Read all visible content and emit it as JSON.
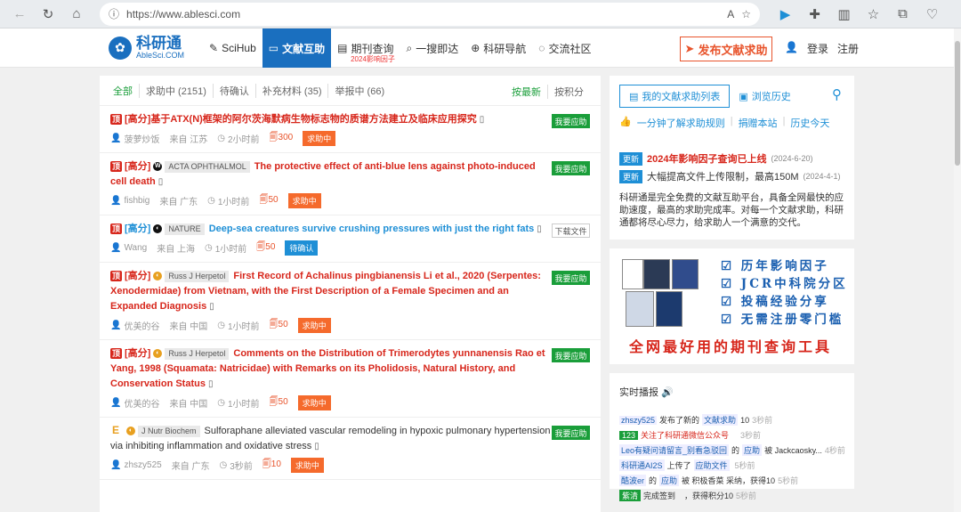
{
  "browser": {
    "url": "https://www.ablesci.com"
  },
  "header": {
    "logo_cn": "科研通",
    "logo_en": "AbleSci.COM",
    "nav": [
      {
        "label": "SciHub",
        "icon": "s"
      },
      {
        "label": "文献互助",
        "icon": "📖"
      },
      {
        "label": "期刊查询",
        "icon": "📄",
        "sub": "2024影响因子"
      },
      {
        "label": "一搜即达",
        "icon": "🔍"
      },
      {
        "label": "科研导航",
        "icon": "🌐"
      },
      {
        "label": "交流社区",
        "icon": "💬"
      }
    ],
    "publish": "发布文献求助",
    "login": "登录",
    "register": "注册"
  },
  "filters": {
    "items": [
      "全部",
      "求助中 (2151)",
      "待确认",
      "补充材料 (35)",
      "举报中 (66)"
    ],
    "sort": [
      "按最新",
      "按积分"
    ]
  },
  "requests": [
    {
      "tag": "顶",
      "prefix": "[高分]",
      "journal": "",
      "title": "基于ATX(N)框架的阿尔茨海默病生物标志物的质谱方法建立及临床应用探究",
      "color": "red",
      "user": "菠萝炒饭",
      "from": "来自 江苏",
      "time": "2小时前",
      "points": "300",
      "status": "求助中",
      "action": "我要应助"
    },
    {
      "tag": "顶",
      "prefix": "[高分]",
      "journal": "ACTA OPHTHALMOL",
      "title": "The protective effect of anti-blue lens against photo-induced cell death",
      "color": "red",
      "user": "fishbig",
      "from": "来自 广东",
      "time": "1小时前",
      "points": "50",
      "status": "求助中",
      "action": "我要应助"
    },
    {
      "tag": "顶",
      "prefix": "[高分]",
      "journal": "NATURE",
      "title": "Deep-sea creatures survive crushing pressures with just the right fats",
      "color": "blue",
      "user": "Wang",
      "from": "来自 上海",
      "time": "1小时前",
      "points": "50",
      "status": "待确认",
      "action": "下载文件"
    },
    {
      "tag": "顶",
      "prefix": "[高分]",
      "journal": "Russ J Herpetol",
      "title": "First Record of Achalinus pingbianensis Li et al., 2020 (Serpentes: Xenodermidae) from Vietnam, with the First Description of a Female Specimen and an Expanded Diagnosis",
      "color": "red",
      "user": "优美的谷",
      "from": "来自 中国",
      "time": "1小时前",
      "points": "50",
      "status": "求助中",
      "action": "我要应助"
    },
    {
      "tag": "顶",
      "prefix": "[高分]",
      "journal": "Russ J Herpetol",
      "title": "Comments on the Distribution of Trimerodytes yunnanensis Rao et Yang, 1998 (Squamata: Natricidae) with Remarks on its Pholidosis, Natural History, and Conservation Status",
      "color": "red",
      "user": "优美的谷",
      "from": "来自 中国",
      "time": "1小时前",
      "points": "50",
      "status": "求助中",
      "action": "我要应助"
    },
    {
      "tag": "E",
      "prefix": "",
      "journal": "J Nutr Biochem",
      "title": "Sulforaphane alleviated vascular remodeling in hypoxic pulmonary hypertension via inhibiting inflammation and oxidative stress",
      "color": "plain",
      "user": "zhszy525",
      "from": "来自 广东",
      "time": "3秒前",
      "points": "10",
      "status": "求助中",
      "action": "我要应助"
    }
  ],
  "sidebar": {
    "my_list": "我的文献求助列表",
    "history": "浏览历史",
    "links": [
      "一分钟了解求助规则",
      "捐赠本站",
      "历史今天"
    ],
    "news": [
      {
        "badge": "更新",
        "text": "2024年影响因子查询已上线",
        "date": "(2024-6-20)"
      },
      {
        "badge": "更新",
        "text": "大幅提高文件上传限制，最高150M",
        "date": "(2024-4-1)"
      }
    ],
    "intro": "科研通是完全免费的文献互助平台，具备全网最快的应助速度，最高的求助完成率。对每一个文献求助，科研通都将尽心尽力，给求助人一个满意的交代。",
    "ad": [
      "☑ 历年影响因子",
      "☑ JCR中科院分区",
      "☑ 投稿经验分享",
      "☑ 无需注册零门槛"
    ],
    "ad_bottom": "全网最好用的期刊查询工具",
    "live_title": "实时播报",
    "feed": [
      {
        "u": "zhszy525",
        "a": "发布了新的",
        "b": "文献求助",
        "c": "10",
        "t": "3秒前"
      },
      {
        "u": "123",
        "a": "关注了科研通微信公众号",
        "b": "",
        "c": "",
        "t": "3秒前"
      },
      {
        "u": "Leo有疑问请留言_别看急驳回",
        "a": "的",
        "b": "应助",
        "c": "被 Jackcaosky...",
        "t": "4秒前"
      },
      {
        "u": "科研通AI2S",
        "a": "上传了",
        "b": "应助文件",
        "c": "",
        "t": "5秒前"
      },
      {
        "u": "酷波er",
        "a": "的",
        "b": "应助",
        "c": "被 积极香菜 采纳，获得10",
        "t": "5秒前"
      },
      {
        "u": "紫清",
        "a": "完成签到",
        "b": "",
        "c": "，获得积分10",
        "t": "5秒前"
      }
    ]
  }
}
